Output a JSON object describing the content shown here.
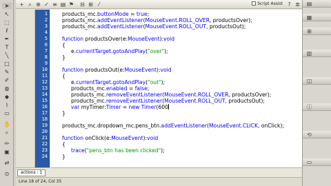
{
  "editor": {
    "script_assist_label": "Script Assist",
    "tab_label": "actions : 1",
    "status_text": "Line 18 of 24, Col 35"
  },
  "line_numbers": [
    "1",
    "2",
    "3",
    "4",
    "5",
    "6",
    "7",
    "8",
    "9",
    "10",
    "11",
    "12",
    "13",
    "14",
    "15",
    "16",
    "17",
    "18",
    "19",
    "20",
    "21",
    "22",
    "23",
    "24"
  ],
  "code": {
    "l1": [
      "products_mc.",
      "buttonMode",
      " = ",
      "true",
      ";"
    ],
    "l2": [
      "products_mc.",
      "addEventListener",
      "(",
      "MouseEvent",
      ".",
      "ROLL_OVER",
      ", productsOver);"
    ],
    "l3": [
      "products_mc.",
      "addEventListener",
      "(",
      "MouseEvent",
      ".",
      "ROLL_OUT",
      ", productsOut);"
    ],
    "l5": [
      "function",
      " productsOver(e:",
      "MouseEvent",
      "):",
      "void"
    ],
    "l6": [
      "{"
    ],
    "l7": [
      "e.",
      "currentTarget",
      ".",
      "gotoAndPlay",
      "(",
      "\"over\"",
      ");"
    ],
    "l8": [
      "}"
    ],
    "l10": [
      "function",
      " productsOut(e:",
      "MouseEvent",
      "):",
      "void"
    ],
    "l11": [
      "{"
    ],
    "l12": [
      "e.",
      "currentTarget",
      ".",
      "gotoAndPlay",
      "(",
      "\"out\"",
      ");"
    ],
    "l13": [
      "products_mc.",
      "enabled",
      " = ",
      "false",
      ";"
    ],
    "l14": [
      "products_mc.",
      "removeEventListener",
      "(",
      "MouseEvent",
      ".",
      "ROLL_OVER",
      ", productsOver);"
    ],
    "l15": [
      "products_mc.",
      "removeEventListener",
      "(",
      "MouseEvent",
      ".",
      "ROLL_OUT",
      ", productsOut);"
    ],
    "l16": [
      "var",
      " myTimer:",
      "Timer",
      " = ",
      "new",
      " ",
      "Timer",
      "(600"
    ],
    "l17": [
      "}"
    ],
    "l19": [
      "products_mc.dropdown_mc.pens_btn.",
      "addEventListener",
      "(",
      "MouseEvent",
      ".",
      "CLICK",
      ", onClick);"
    ],
    "l21": [
      "function",
      " onClick(e:",
      "MouseEvent",
      "):",
      "void"
    ],
    "l22": [
      "{"
    ],
    "l23": [
      "trace",
      "(",
      "\"pens_btn has been clicked\"",
      ");"
    ],
    "l24": [
      "}"
    ]
  }
}
